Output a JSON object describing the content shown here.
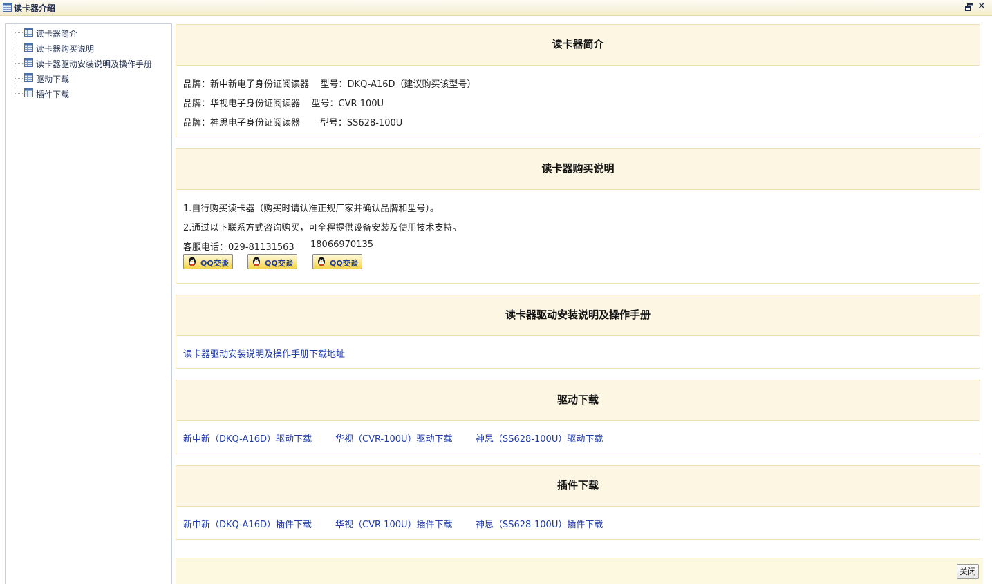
{
  "window": {
    "title": "读卡器介绍",
    "title_icon": "grid-doc-icon",
    "restore_icon": "restore-window-icon",
    "close_icon": "close-icon",
    "close_glyph": "✕"
  },
  "sidebar": {
    "items": [
      {
        "label": "读卡器简介",
        "icon": "doc-icon"
      },
      {
        "label": "读卡器购买说明",
        "icon": "doc-icon"
      },
      {
        "label": "读卡器驱动安装说明及操作手册",
        "icon": "doc-icon"
      },
      {
        "label": "驱动下载",
        "icon": "doc-icon"
      },
      {
        "label": "插件下载",
        "icon": "doc-icon"
      }
    ]
  },
  "intro": {
    "title": "读卡器简介",
    "lines": [
      "品牌：新中新电子身份证阅读器    型号：DKQ-A16D（建议购买该型号）",
      "品牌：华视电子身份证阅读器    型号：CVR-100U",
      "品牌：神思电子身份证阅读器       型号：SS628-100U"
    ]
  },
  "purchase": {
    "title": "读卡器购买说明",
    "lines": [
      "1.自行购买读卡器（购买时请认准正规厂家并确认品牌和型号）。",
      "2.通过以下联系方式咨询购买，可全程提供设备安装及使用技术支持。"
    ],
    "phone_label": "客服电话：029-81131563",
    "phone_2": "18066970135",
    "qq_buttons": [
      "QQ交谈",
      "QQ交谈",
      "QQ交谈"
    ]
  },
  "manual": {
    "title": "读卡器驱动安装说明及操作手册",
    "link": "读卡器驱动安装说明及操作手册下载地址"
  },
  "drivers": {
    "title": "驱动下载",
    "links": [
      "新中新（DKQ-A16D）驱动下载",
      "华视（CVR-100U）驱动下载",
      "神思（SS628-100U）驱动下载"
    ]
  },
  "plugins": {
    "title": "插件下载",
    "links": [
      "新中新（DKQ-A16D）插件下载",
      "华视（CVR-100U）插件下载",
      "神思（SS628-100U）插件下载"
    ]
  },
  "footer": {
    "close_label": "关闭"
  },
  "colors": {
    "panel_header_bg": "#fcf6e3",
    "panel_border": "#ede0b4",
    "link": "#1f3ba6",
    "footer_bg": "#fdf9e1"
  }
}
